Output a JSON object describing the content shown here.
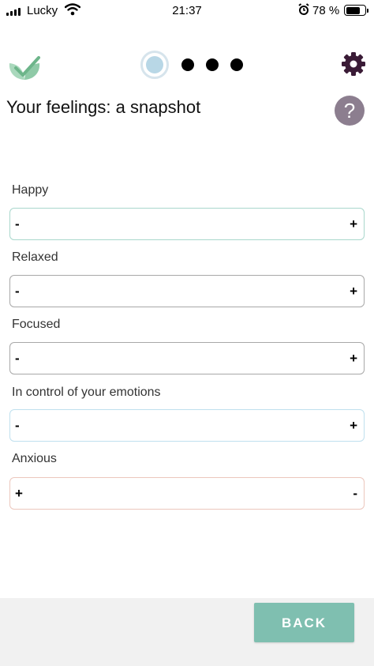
{
  "status_bar": {
    "carrier": "Lucky",
    "time": "21:37",
    "battery_percent": "78 %",
    "battery_level": 0.78
  },
  "header": {
    "progress": {
      "current_step": 1,
      "total_steps": 4
    },
    "title": "Your feelings: a snapshot",
    "help_label": "?"
  },
  "feelings": [
    {
      "label": "Happy",
      "left_end": "-",
      "right_end": "+",
      "color": "#a9d7cc"
    },
    {
      "label": "Relaxed",
      "left_end": "-",
      "right_end": "+",
      "color": "#a8a8a8"
    },
    {
      "label": "Focused",
      "left_end": "-",
      "right_end": "+",
      "color": "#a8a8a8"
    },
    {
      "label": "In control of your emotions",
      "left_end": "-",
      "right_end": "+",
      "color": "#bfe0ee"
    },
    {
      "label": "Anxious",
      "left_end": "+",
      "right_end": "-",
      "color": "#ecc7bd"
    }
  ],
  "footer": {
    "back_label": "BACK",
    "accent_color": "#7fbfb0"
  },
  "icons": {
    "logo": "leaf-check-logo",
    "settings": "gear-icon",
    "help": "help-icon"
  }
}
